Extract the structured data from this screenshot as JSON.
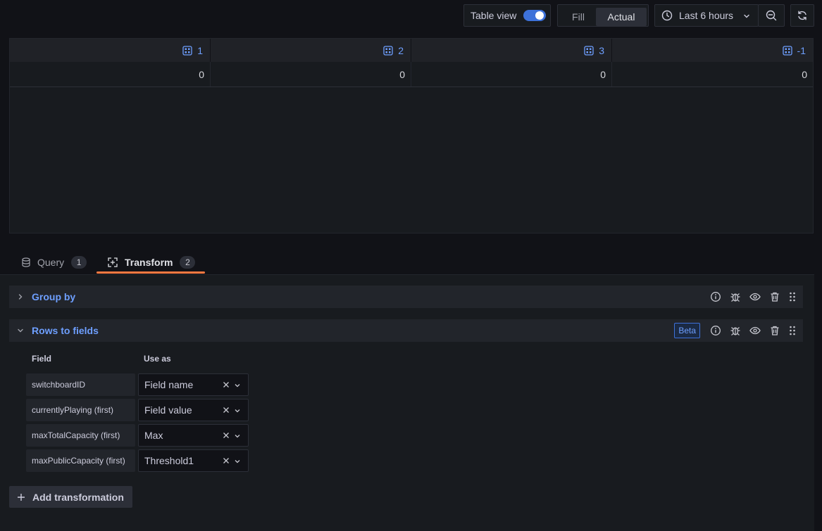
{
  "toolbar": {
    "table_view_label": "Table view",
    "table_view_on": true,
    "fill_label": "Fill",
    "actual_label": "Actual",
    "time_range_label": "Last 6 hours"
  },
  "table": {
    "columns": [
      {
        "label": "1"
      },
      {
        "label": "2"
      },
      {
        "label": "3"
      },
      {
        "label": "-1"
      }
    ],
    "rows": [
      [
        "0",
        "0",
        "0",
        "0"
      ]
    ]
  },
  "tabs": [
    {
      "label": "Query",
      "count": "1",
      "active": false
    },
    {
      "label": "Transform",
      "count": "2",
      "active": true
    }
  ],
  "transformations": [
    {
      "title": "Group by",
      "expanded": false
    },
    {
      "title": "Rows to fields",
      "expanded": true,
      "badge": "Beta"
    }
  ],
  "rows_to_fields": {
    "field_header": "Field",
    "use_as_header": "Use as",
    "mappings": [
      {
        "field": "switchboardID",
        "use_as": "Field name"
      },
      {
        "field": "currentlyPlaying (first)",
        "use_as": "Field value"
      },
      {
        "field": "maxTotalCapacity (first)",
        "use_as": "Max"
      },
      {
        "field": "maxPublicCapacity (first)",
        "use_as": "Threshold1"
      }
    ]
  },
  "add_transformation_label": "Add transformation",
  "colors": {
    "accent": "#3d71d9",
    "link": "#6e9fff",
    "active_tab_underline": "#ff7941",
    "background": "#111217",
    "panel": "#181b1f"
  }
}
